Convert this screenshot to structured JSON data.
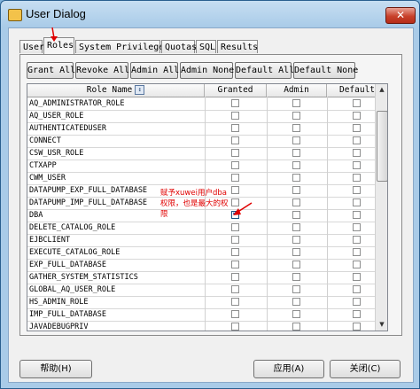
{
  "window": {
    "title": "User Dialog",
    "close_glyph": "✕"
  },
  "tabs": [
    {
      "label": "User"
    },
    {
      "label": "Roles"
    },
    {
      "label": "System Privileges"
    },
    {
      "label": "Quotas"
    },
    {
      "label": "SQL"
    },
    {
      "label": "Results"
    }
  ],
  "toolbar": {
    "grant_all": "Grant All",
    "revoke_all": "Revoke All",
    "admin_all": "Admin All",
    "admin_none": "Admin None",
    "default_all": "Default All",
    "default_none": "Default None"
  },
  "grid": {
    "headers": {
      "role_name": "Role Name",
      "granted": "Granted",
      "admin": "Admin",
      "default": "Default"
    },
    "sort_glyph": "↕",
    "rows": [
      {
        "name": "AQ_ADMINISTRATOR_ROLE",
        "granted": false,
        "admin": false,
        "default": false
      },
      {
        "name": "AQ_USER_ROLE",
        "granted": false,
        "admin": false,
        "default": false
      },
      {
        "name": "AUTHENTICATEDUSER",
        "granted": false,
        "admin": false,
        "default": false
      },
      {
        "name": "CONNECT",
        "granted": false,
        "admin": false,
        "default": false
      },
      {
        "name": "CSW_USR_ROLE",
        "granted": false,
        "admin": false,
        "default": false
      },
      {
        "name": "CTXAPP",
        "granted": false,
        "admin": false,
        "default": false
      },
      {
        "name": "CWM_USER",
        "granted": false,
        "admin": false,
        "default": false
      },
      {
        "name": "DATAPUMP_EXP_FULL_DATABASE",
        "granted": false,
        "admin": false,
        "default": false
      },
      {
        "name": "DATAPUMP_IMP_FULL_DATABASE",
        "granted": false,
        "admin": false,
        "default": false
      },
      {
        "name": "DBA",
        "granted": true,
        "admin": false,
        "default": false
      },
      {
        "name": "DELETE_CATALOG_ROLE",
        "granted": false,
        "admin": false,
        "default": false
      },
      {
        "name": "EJBCLIENT",
        "granted": false,
        "admin": false,
        "default": false
      },
      {
        "name": "EXECUTE_CATALOG_ROLE",
        "granted": false,
        "admin": false,
        "default": false
      },
      {
        "name": "EXP_FULL_DATABASE",
        "granted": false,
        "admin": false,
        "default": false
      },
      {
        "name": "GATHER_SYSTEM_STATISTICS",
        "granted": false,
        "admin": false,
        "default": false
      },
      {
        "name": "GLOBAL_AQ_USER_ROLE",
        "granted": false,
        "admin": false,
        "default": false
      },
      {
        "name": "HS_ADMIN_ROLE",
        "granted": false,
        "admin": false,
        "default": false
      },
      {
        "name": "IMP_FULL_DATABASE",
        "granted": false,
        "admin": false,
        "default": false
      },
      {
        "name": "JAVADEBUGPRIV",
        "granted": false,
        "admin": false,
        "default": false
      }
    ],
    "check_glyph": "✔",
    "scroll_up_glyph": "▲",
    "scroll_down_glyph": "▼"
  },
  "annotation": {
    "text": "赋予xuwei用户dba权限，也是最大的权限",
    "color": "#e00000"
  },
  "footer": {
    "help": "帮助(H)",
    "apply": "应用(A)",
    "close": "关闭(C)"
  }
}
